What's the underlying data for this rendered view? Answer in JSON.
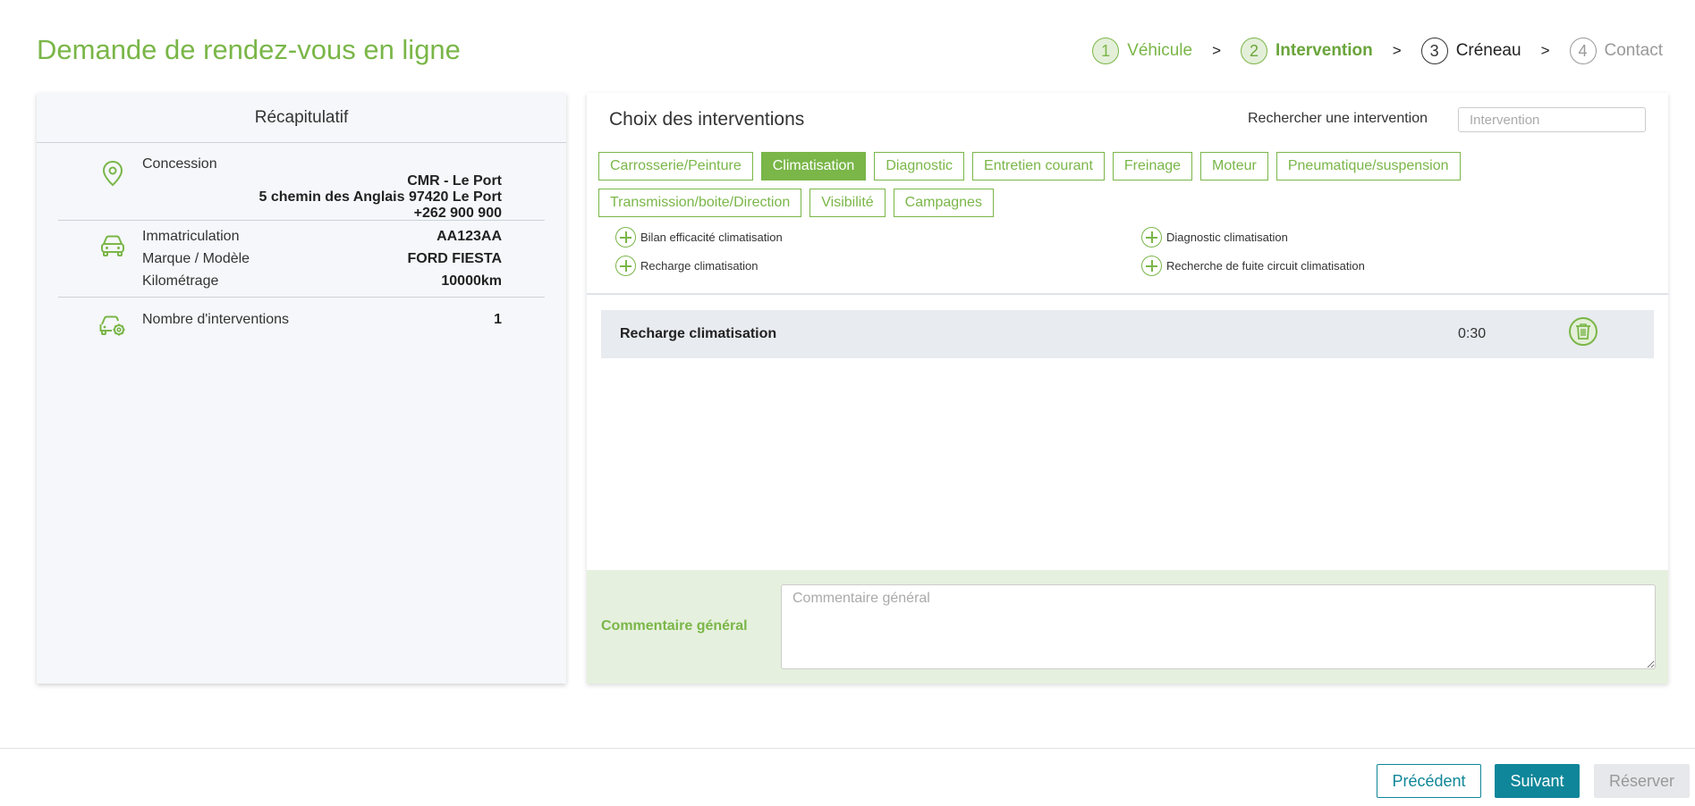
{
  "header": {
    "title": "Demande de rendez-vous en ligne"
  },
  "stepper": {
    "steps": [
      {
        "num": "1",
        "label": "Véhicule"
      },
      {
        "num": "2",
        "label": "Intervention"
      },
      {
        "num": "3",
        "label": "Créneau"
      },
      {
        "num": "4",
        "label": "Contact"
      }
    ],
    "separator": ">"
  },
  "summary": {
    "title": "Récapitulatif",
    "dealer": {
      "label": "Concession",
      "name": "CMR - Le Port",
      "address": "5 chemin des Anglais 97420 Le Port",
      "phone": "+262 900 900"
    },
    "vehicle": {
      "plate_label": "Immatriculation",
      "plate": "AA123AA",
      "model_label": "Marque / Modèle",
      "model": "FORD FIESTA",
      "mileage_label": "Kilométrage",
      "mileage": "10000km"
    },
    "interventions": {
      "label": "Nombre d'interventions",
      "count": "1"
    }
  },
  "interventions_panel": {
    "title": "Choix des interventions",
    "search_label": "Rechercher une intervention",
    "search_placeholder": "Intervention",
    "tabs": [
      "Carrosserie/Peinture",
      "Climatisation",
      "Diagnostic",
      "Entretien courant",
      "Freinage",
      "Moteur",
      "Pneumatique/suspension",
      "Transmission/boite/Direction",
      "Visibilité",
      "Campagnes"
    ],
    "active_tab": "Climatisation",
    "options": [
      "Bilan efficacité climatisation",
      "Diagnostic climatisation",
      "Recharge climatisation",
      "Recherche de fuite circuit climatisation"
    ],
    "selected": [
      {
        "label": "Recharge climatisation",
        "duration": "0:30"
      }
    ],
    "comment_label": "Commentaire général",
    "comment_placeholder": "Commentaire général"
  },
  "footer": {
    "prev_label": "Précédent",
    "next_label": "Suivant",
    "book_label": "Réserver"
  },
  "colors": {
    "brand_green": "#7ab648",
    "teal": "#0f8699",
    "disabled": "#e6e8eb"
  }
}
